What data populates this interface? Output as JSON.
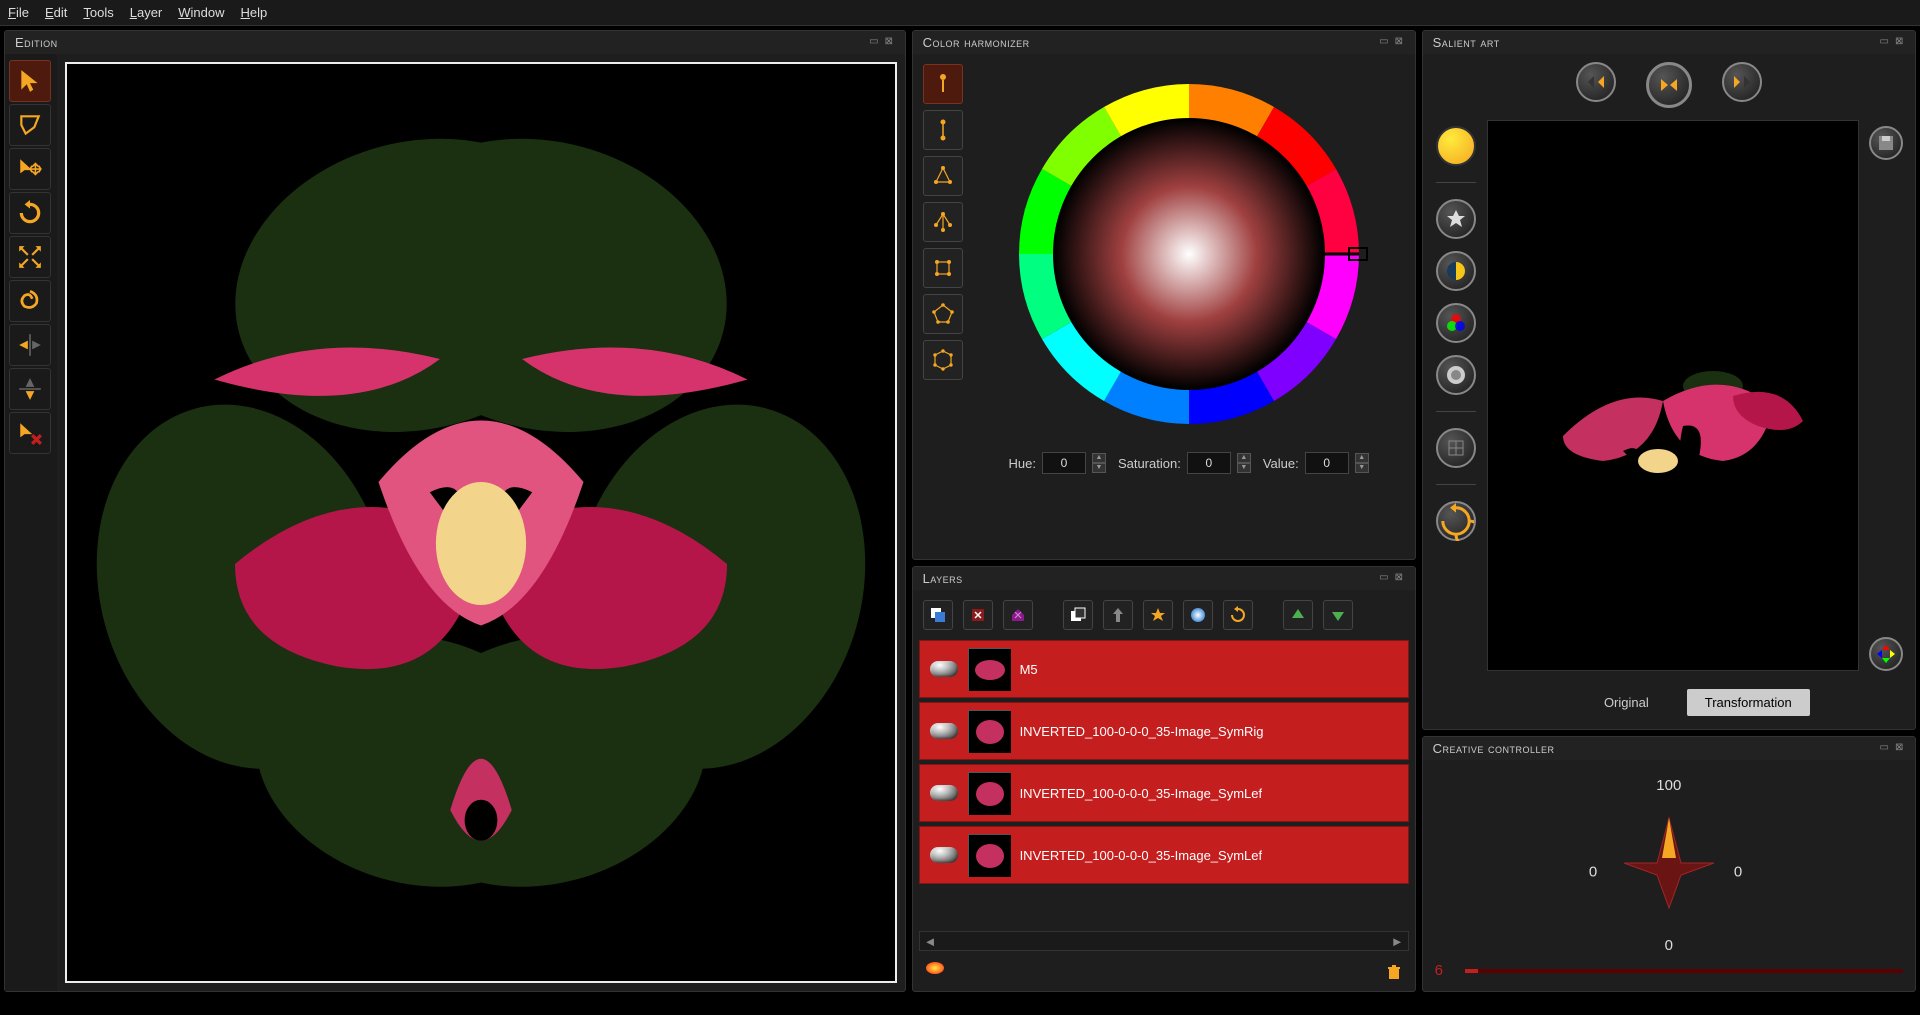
{
  "menu": {
    "file": "File",
    "edit": "Edit",
    "tools": "Tools",
    "layer": "Layer",
    "window": "Window",
    "help": "Help"
  },
  "panels": {
    "edition": "Edition",
    "color_harmonizer": "Color harmonizer",
    "layers": "Layers",
    "salient_art": "Salient art",
    "creative_controller": "Creative controller"
  },
  "toolbar": {
    "items": [
      {
        "name": "pointer-tool",
        "active": true
      },
      {
        "name": "lasso-tool",
        "active": false
      },
      {
        "name": "move-tool",
        "active": false
      },
      {
        "name": "rotate-tool",
        "active": false
      },
      {
        "name": "scale-tool",
        "active": false
      },
      {
        "name": "swirl-tool",
        "active": false
      },
      {
        "name": "flip-horizontal-tool",
        "active": false
      },
      {
        "name": "flip-vertical-tool",
        "active": false
      },
      {
        "name": "delete-tool",
        "active": false
      }
    ]
  },
  "harmony": {
    "schemes": [
      {
        "name": "mono-scheme",
        "active": true
      },
      {
        "name": "complementary-scheme",
        "active": false
      },
      {
        "name": "triad-scheme",
        "active": false
      },
      {
        "name": "split-scheme",
        "active": false
      },
      {
        "name": "square-scheme",
        "active": false
      },
      {
        "name": "pentagon-scheme",
        "active": false
      },
      {
        "name": "hexagon-scheme",
        "active": false
      }
    ],
    "hue_label": "Hue:",
    "hue_value": "0",
    "sat_label": "Saturation:",
    "sat_value": "0",
    "val_label": "Value:",
    "val_value": "0"
  },
  "layers": {
    "toolbar": [
      "new-layer",
      "delete-layer",
      "duplicate-layer",
      "copy-layer",
      "merge-layer",
      "effects-layer",
      "color-layer",
      "reset-layer",
      "move-up",
      "move-down"
    ],
    "items": [
      {
        "name": "M5"
      },
      {
        "name": "INVERTED_100-0-0-0_35-Image_SymRig"
      },
      {
        "name": "INVERTED_100-0-0-0_35-Image_SymLef"
      },
      {
        "name": "INVERTED_100-0-0-0_35-Image_SymLef"
      }
    ]
  },
  "salient": {
    "original_tab": "Original",
    "transformation_tab": "Transformation",
    "active_tab": "transformation"
  },
  "creative": {
    "top": "100",
    "left": "0",
    "right": "0",
    "bottom": "0",
    "slider_value": "6"
  }
}
